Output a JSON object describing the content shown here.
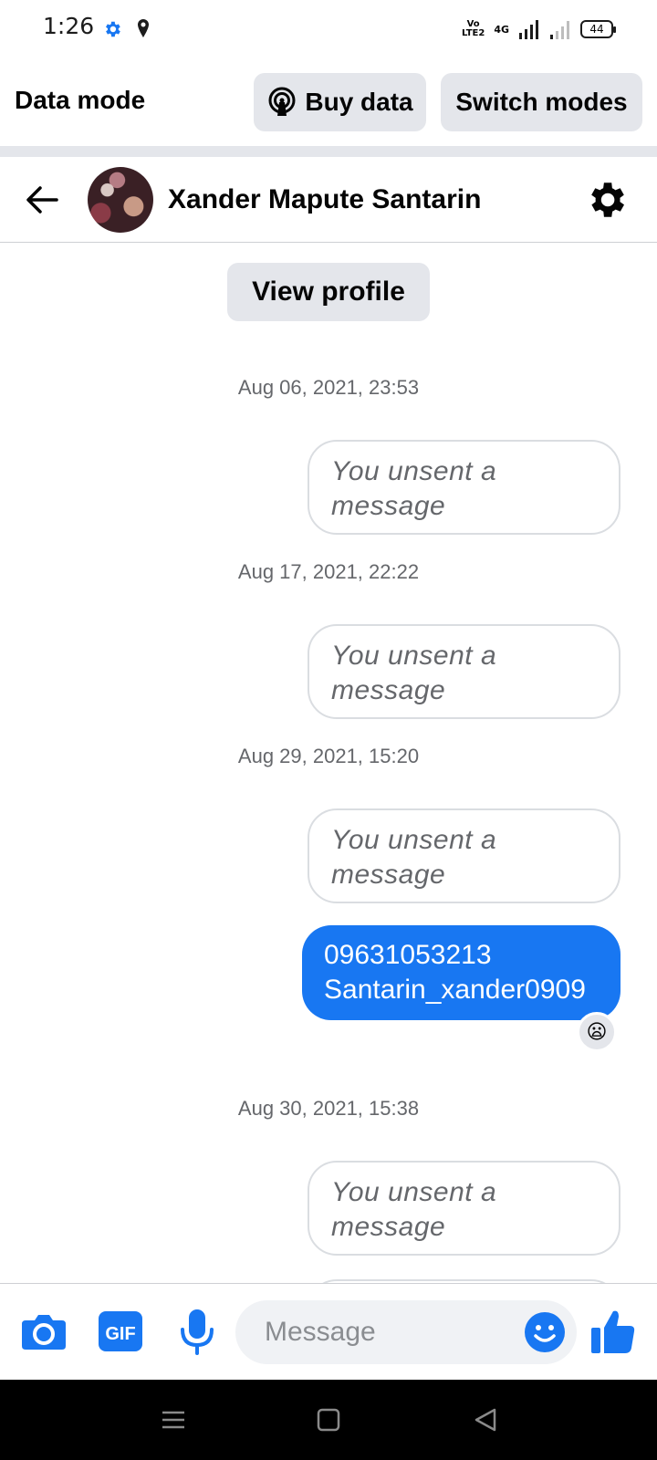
{
  "status_bar": {
    "time": "1:26",
    "volte_label_top": "Vo",
    "volte_label_bottom": "LTE2",
    "network": "4G",
    "battery": "44"
  },
  "data_mode": {
    "title": "Data mode",
    "buy_label": "Buy data",
    "switch_label": "Switch modes"
  },
  "chat": {
    "contact_name": "Xander Mapute Santarin",
    "view_profile_label": "View profile",
    "messages": [
      {
        "timestamp": "Aug 06, 2021, 23:53",
        "text_line1": "You unsent a",
        "text_line2": "message"
      },
      {
        "timestamp": "Aug 17, 2021, 22:22",
        "text_line1": "You unsent a",
        "text_line2": "message"
      },
      {
        "timestamp": "Aug 29, 2021, 15:20",
        "text_line1": "You unsent a",
        "text_line2": "message"
      },
      {
        "sent_line1": "09631053213",
        "sent_line2": "Santarin_xander0909",
        "reaction": "😦"
      },
      {
        "timestamp": "Aug 30, 2021, 15:38",
        "text_line1": "You unsent a",
        "text_line2": "message"
      }
    ]
  },
  "composer": {
    "placeholder": "Message",
    "gif_label": "GIF"
  },
  "colors": {
    "accent": "#1877f2",
    "pill_bg": "#e4e6eb",
    "timestamp_text": "#65676b"
  }
}
